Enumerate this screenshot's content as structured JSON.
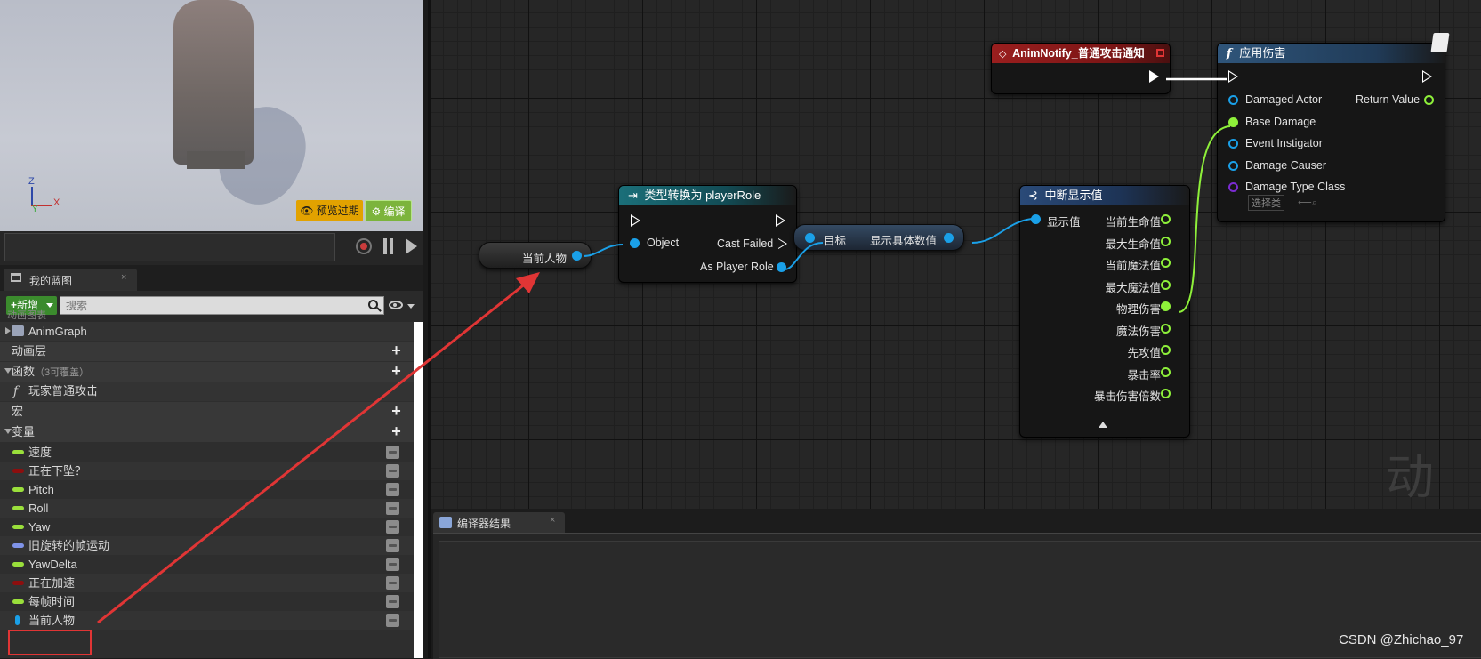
{
  "viewport": {
    "axis_z": "Z",
    "axis_x": "X",
    "axis_y": "Y",
    "preview_label": "预览过期",
    "compile_label": "编译"
  },
  "my_blueprint": {
    "tab_label": "我的蓝图",
    "tab_close": "×",
    "add_label": "新增",
    "search_placeholder": "搜索",
    "tree": {
      "anim_graph_section": "动画图表",
      "anim_graph": "AnimGraph",
      "anim_layers": "动画层",
      "functions": "函数",
      "functions_sub": "（3可覆盖）",
      "function_item": "玩家普通攻击",
      "macros": "宏",
      "variables": "变量"
    },
    "variables": [
      {
        "name": "速度",
        "color": "#9adf3b"
      },
      {
        "name": "正在下坠？",
        "color": "#8d0e0e"
      },
      {
        "name": "Pitch",
        "color": "#9adf3b"
      },
      {
        "name": "Roll",
        "color": "#9adf3b"
      },
      {
        "name": "Yaw",
        "color": "#9adf3b"
      },
      {
        "name": "旧旋转的帧运动",
        "color": "#7f93e8"
      },
      {
        "name": "YawDelta",
        "color": "#9adf3b"
      },
      {
        "name": "正在加速",
        "color": "#8d0e0e"
      },
      {
        "name": "每帧时间",
        "color": "#9adf3b"
      },
      {
        "name": "当前人物",
        "color": "#1aa0e8"
      }
    ]
  },
  "graph": {
    "watermark": "动画",
    "getter_current_character": "当前人物",
    "cast_node": {
      "title": "类型转换为 playerRole",
      "object_pin": "Object",
      "cast_failed_pin": "Cast Failed",
      "as_player_role_pin": "As Player Role"
    },
    "get_value_node": {
      "target_pin": "目标",
      "output_pin": "显示具体数值"
    },
    "break_node": {
      "title": "中断显示值",
      "input_pin": "显示值",
      "outputs": [
        "当前生命值",
        "最大生命值",
        "当前魔法值",
        "最大魔法值",
        "物理伤害",
        "魔法伤害",
        "先攻值",
        "暴击率",
        "暴击伤害倍数"
      ]
    },
    "notify_node": {
      "title": "AnimNotify_普通攻击通知"
    },
    "apply_damage_node": {
      "title": "应用伤害",
      "function_glyph": "f",
      "pins": [
        "Damaged Actor",
        "Base Damage",
        "Event Instigator",
        "Damage Causer",
        "Damage Type Class"
      ],
      "return_value": "Return Value",
      "select_class": "选择类"
    }
  },
  "results": {
    "tab_label": "编译器结果",
    "tab_close": "×"
  },
  "credit": "CSDN @Zhichao_97",
  "colors": {
    "exec": "#ffffff",
    "object_pin": "#1aa0e8",
    "float_pin": "#8ef03a",
    "class_pin": "#7b2bd1",
    "annotation_red": "#e03535"
  }
}
